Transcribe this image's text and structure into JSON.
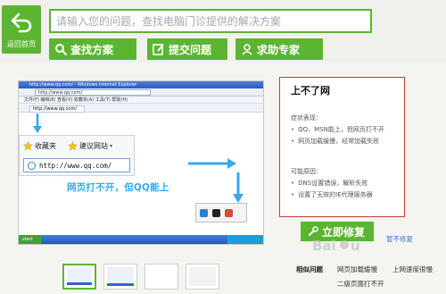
{
  "back": {
    "label": "返回首页"
  },
  "search": {
    "placeholder": "请输入您的问题，查找电脑门诊提供的解决方案"
  },
  "actions": {
    "find": "查找方案",
    "submit": "提交问题",
    "expert": "求助专家"
  },
  "screenshot": {
    "window_title": "http://www.qq.com/ - Windows Internet Explorer",
    "address": "http://www.qq.com/",
    "menu": "文件(F)  编辑(E)  查看(V)  收藏夹(A)  工具(T)  帮助(H)",
    "tab": "http://www.qq.com/",
    "favorites": "收藏夹",
    "suggested_sites": "建议网站",
    "zoom_url": "http://www.qq.com/",
    "caption": "网页打不开，但QQ能上",
    "start": "start"
  },
  "panel": {
    "title": "上不了网",
    "symptoms_label": "症状表现：",
    "symptoms": [
      "QQ、MSN能上，但网页打不开",
      "网页加载缓慢，经常加载失败"
    ],
    "causes_label": "可能原因：",
    "causes": [
      "DNS设置错误，解析失败",
      "设置了无效的IE代理服务器"
    ]
  },
  "fix": {
    "label": "立即修复",
    "nofix": "暂不修复"
  },
  "related": {
    "title": "相似问题",
    "items": [
      "网页加载缓慢",
      "上网速度很慢",
      "二级页面打不开"
    ]
  },
  "colors": {
    "brand_green": "#5cb531",
    "panel_border": "#c43c3c",
    "caption_blue": "#34a9ea",
    "link_blue": "#3b78c9"
  }
}
